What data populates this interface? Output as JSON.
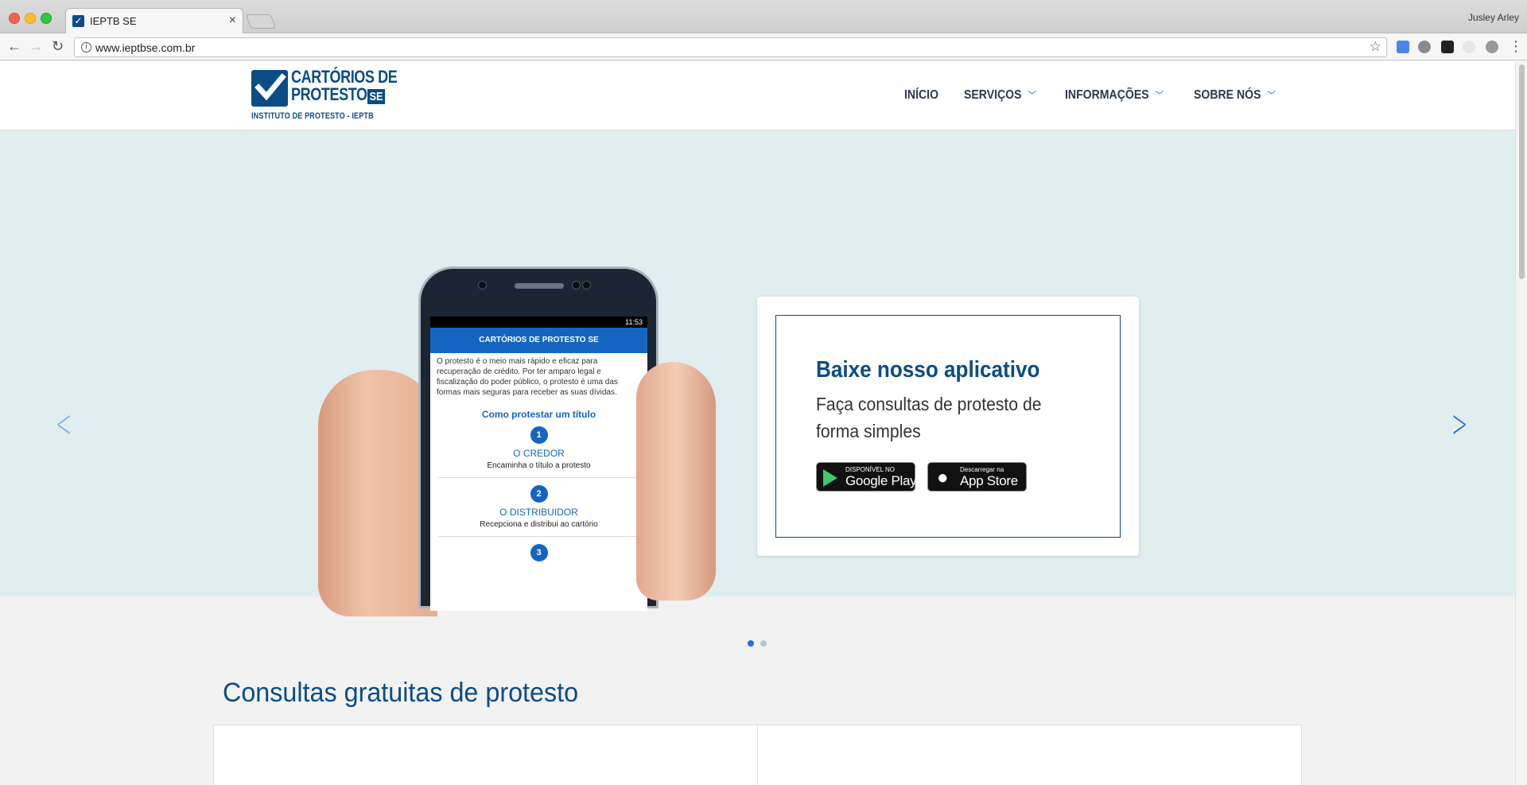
{
  "browser": {
    "tab_title": "IEPTB SE",
    "url": "www.ieptbse.com.br",
    "profile_name": "Jusley Arley"
  },
  "header": {
    "logo": {
      "line1": "CARTÓRIOS DE",
      "line2": "PROTESTO",
      "badge": "SE",
      "line3": "INSTITUTO DE PROTESTO - IEPTB"
    },
    "menu": [
      {
        "label": "INÍCIO",
        "has_dropdown": false
      },
      {
        "label": "SERVIÇOS",
        "has_dropdown": true
      },
      {
        "label": "INFORMAÇÕES",
        "has_dropdown": true
      },
      {
        "label": "SOBRE NÓS",
        "has_dropdown": true
      }
    ]
  },
  "hero": {
    "card": {
      "title": "Baixe nosso aplicativo",
      "subtitle": "Faça consultas de protesto de forma simples",
      "google_play": {
        "small": "DISPONÍVEL NO",
        "big": "Google Play"
      },
      "app_store": {
        "small": "Descarregar na",
        "big": "App Store"
      }
    },
    "phone": {
      "time": "11:53",
      "app_logo": "CARTÓRIOS DE PROTESTO SE",
      "intro": "O protesto é o meio mais rápido e eficaz para recuperação de crédito. Por ter amparo legal e fiscalização do poder público, o protesto é uma das formas mais seguras para receber as suas dívidas.",
      "heading": "Como protestar um título",
      "steps": [
        {
          "num": "1",
          "title": "O CREDOR",
          "desc": "Encaminha o título a protesto"
        },
        {
          "num": "2",
          "title": "O DISTRIBUIDOR",
          "desc": "Recepciona e distribui ao cartório"
        },
        {
          "num": "3",
          "title": "",
          "desc": ""
        }
      ]
    },
    "carousel": {
      "slides": 2,
      "active": 1
    }
  },
  "section": {
    "title": "Consultas gratuitas de protesto"
  },
  "colors": {
    "brand": "#0b4c85",
    "accent": "#1a6fc4",
    "hero_bg": "#e0eef0"
  }
}
